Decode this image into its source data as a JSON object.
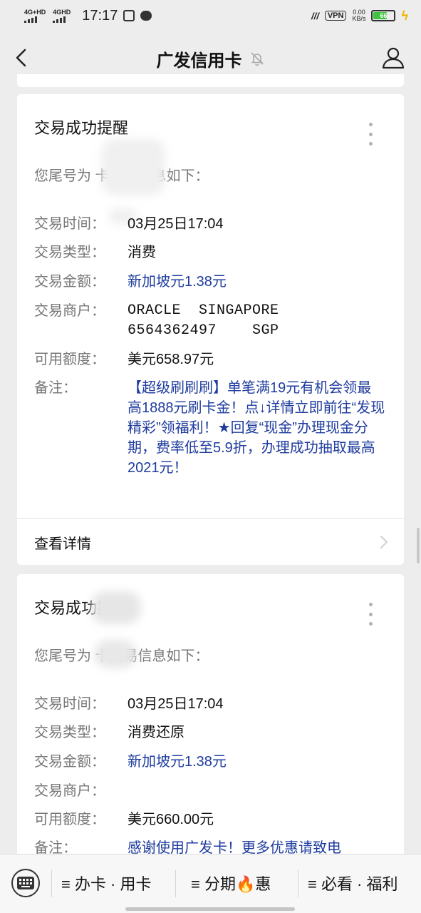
{
  "status_bar": {
    "network1": "4G+HD",
    "network2": "4GHD",
    "time": "17:17",
    "vpn": "VPN",
    "speed_value": "0.00",
    "speed_unit": "KB/s",
    "battery": "66",
    "battery_level": 0.62
  },
  "nav": {
    "title": "广发信用卡"
  },
  "messages": [
    {
      "title": "交易成功提醒",
      "intro": "您尾号为      卡交易信息如下：",
      "rows": [
        {
          "label": "交易时间：",
          "value": "03月25日17:04"
        },
        {
          "label": "交易类型：",
          "value": "消费"
        },
        {
          "label": "交易金额：",
          "value": "新加坡元1.38元"
        },
        {
          "label": "交易商户：",
          "value": "ORACLE  SINGAPORE 6564362497    SGP"
        },
        {
          "label": "可用额度：",
          "value": "美元658.97元"
        },
        {
          "label": "备注：",
          "value": "【超级刷刷刷】单笔满19元有机会领最高1888元刷卡金！点↓详情立即前往“发现精彩”领福利！★回复“现金”办理现金分期，费率低至5.9折，办理成功抽取最高2021元！"
        }
      ],
      "detail": "查看详情"
    },
    {
      "title": "交易成功提醒",
      "intro": "您尾号为      卡交易信息如下：",
      "rows": [
        {
          "label": "交易时间：",
          "value": "03月25日17:04"
        },
        {
          "label": "交易类型：",
          "value": "消费还原"
        },
        {
          "label": "交易金额：",
          "value": "新加坡元1.38元"
        },
        {
          "label": "交易商户：",
          "value": ""
        },
        {
          "label": "可用额度：",
          "value": "美元660.00元"
        },
        {
          "label": "备注：",
          "value": "感谢使用广发卡！更多优惠请致电"
        }
      ]
    }
  ],
  "menu": {
    "item1": "≡ 办卡 · 用卡",
    "item2_a": "≡ 分期",
    "item2_emoji": "🔥",
    "item2_b": "惠",
    "item3": "≡ 必看 · 福利"
  },
  "colors": {
    "accent_blue": "#1e3b9e",
    "label_gray": "#777777",
    "background": "#ededed",
    "battery_green": "#3ec43e"
  },
  "icons": [
    "back-arrow-icon",
    "mute-bell-icon",
    "profile-icon",
    "more-dots-icon",
    "chevron-right-icon",
    "keyboard-icon"
  ]
}
